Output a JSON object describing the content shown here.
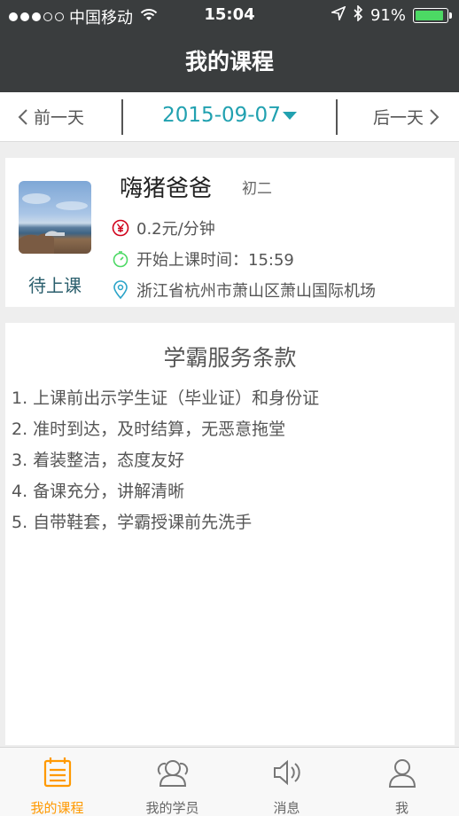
{
  "status_bar": {
    "carrier": "中国移动",
    "time": "15:04",
    "battery": "91%",
    "battery_level": 0.91,
    "icons": [
      "signal-dots-icon",
      "wifi-icon",
      "location-arrow-icon",
      "bluetooth-icon",
      "battery-icon"
    ]
  },
  "header": {
    "title": "我的课程"
  },
  "date_nav": {
    "prev_label": "前一天",
    "date": "2015-09-07",
    "next_label": "后一天"
  },
  "course": {
    "name": "嗨猪爸爸",
    "grade": "初二",
    "status": "待上课",
    "price": "0.2元/分钟",
    "start_time": "开始上课时间：15:59",
    "location": "浙江省杭州市萧山区萧山国际机场",
    "icons": [
      "yen-icon",
      "stopwatch-icon",
      "location-pin-icon"
    ]
  },
  "terms": {
    "title": "学霸服务条款",
    "items": [
      "1. 上课前出示学生证（毕业证）和身份证",
      "2. 准时到达，及时结算，无恶意拖堂",
      "3. 着装整洁，态度友好",
      "4. 备课充分，讲解清晰",
      "5. 自带鞋套，学霸授课前先洗手"
    ]
  },
  "tabs": [
    {
      "label": "我的课程",
      "icon": "calendar-icon",
      "active": true
    },
    {
      "label": "我的学员",
      "icon": "users-icon",
      "active": false
    },
    {
      "label": "消息",
      "icon": "speaker-icon",
      "active": false
    },
    {
      "label": "我",
      "icon": "user-icon",
      "active": false
    }
  ],
  "colors": {
    "header_bg": "#3a3d3e",
    "accent_teal": "#21a1b0",
    "accent_orange": "#ff9900",
    "price_red": "#d0021b",
    "timer_green": "#4cd964",
    "pin_blue": "#29a3c8"
  }
}
